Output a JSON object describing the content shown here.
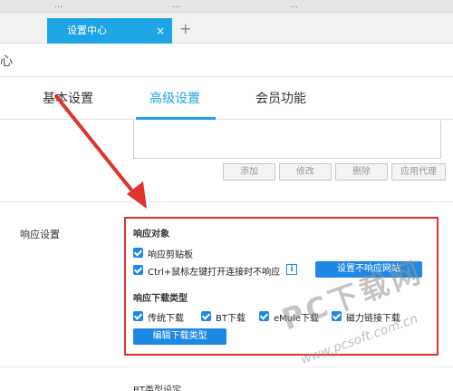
{
  "browser": {
    "prev_tabs": [
      "…",
      "…",
      "…"
    ],
    "active_tab": "设置中心",
    "close_glyph": "×",
    "new_tab_glyph": "+",
    "address_glyph": "心"
  },
  "nav": {
    "tabs": [
      "基本设置",
      "高级设置",
      "会员功能"
    ],
    "active_index": 1
  },
  "proxy": {
    "buttons": [
      "添加",
      "修改",
      "删除",
      "应用代理"
    ]
  },
  "response": {
    "section_label": "响应设置",
    "object_header": "响应对象",
    "clipboard_label": "响应剪贴板",
    "ctrl_label": "Ctrl+鼠标左键打开连接时不响应",
    "info_glyph": "i",
    "set_sites_button": "设置不响应网站",
    "types_header": "响应下载类型",
    "types": [
      "传统下载",
      "BT下载",
      "eMule下载",
      "磁力链接下载"
    ],
    "edit_types_button": "编辑下载类型"
  },
  "bottom": {
    "partial_text": "BT类型设定"
  },
  "watermark": {
    "big": "PC下载网",
    "small": "www.pcsoft.com.cn"
  },
  "colors": {
    "accent": "#1ea5e5",
    "checkbox": "#1e88e5",
    "annotation_red": "#e2322e"
  }
}
